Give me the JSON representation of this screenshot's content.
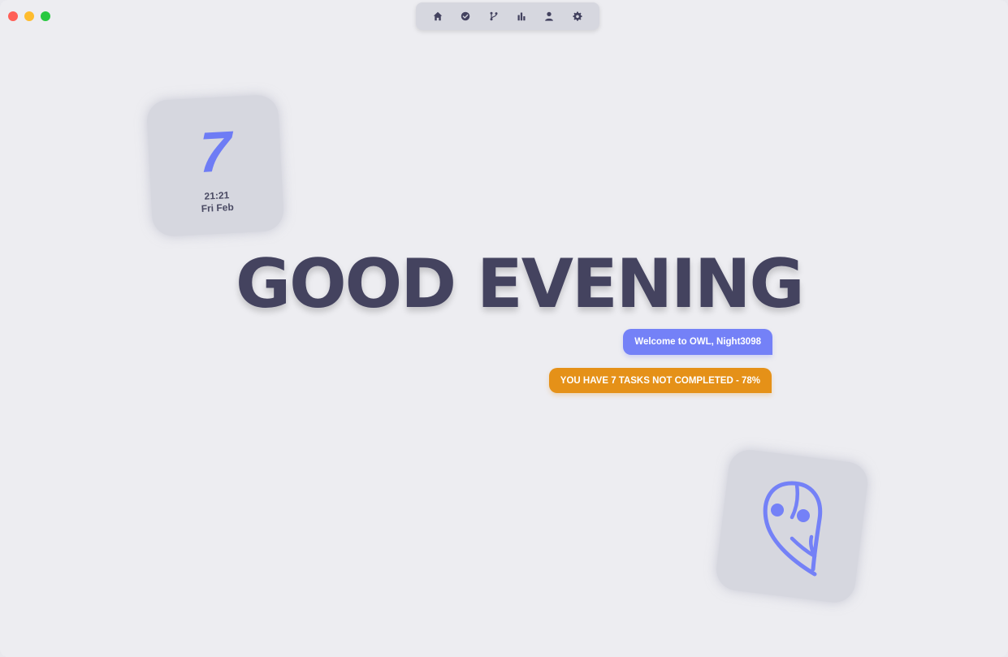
{
  "window": {
    "controls": [
      "close",
      "minimize",
      "maximize"
    ]
  },
  "navbar": {
    "items": [
      {
        "name": "home",
        "icon": "home-icon"
      },
      {
        "name": "tasks",
        "icon": "check-circle-icon"
      },
      {
        "name": "branches",
        "icon": "git-branch-icon"
      },
      {
        "name": "stats",
        "icon": "bar-chart-icon"
      },
      {
        "name": "profile",
        "icon": "user-icon"
      },
      {
        "name": "settings",
        "icon": "gear-icon"
      }
    ]
  },
  "date_card": {
    "day": "7",
    "time": "21:21",
    "date": "Fri Feb"
  },
  "greeting": "GOOD EVENING",
  "welcome": "Welcome to OWL, Night3098",
  "tasks_notice": "YOU HAVE 7 TASKS NOT COMPLETED - 78%",
  "colors": {
    "accent": "#7481f7",
    "warning": "#e59118",
    "text_dark": "#44435f",
    "card_bg": "#d6d7df",
    "background": "#ededf1"
  },
  "logo": {
    "icon": "owl-logo-icon"
  }
}
